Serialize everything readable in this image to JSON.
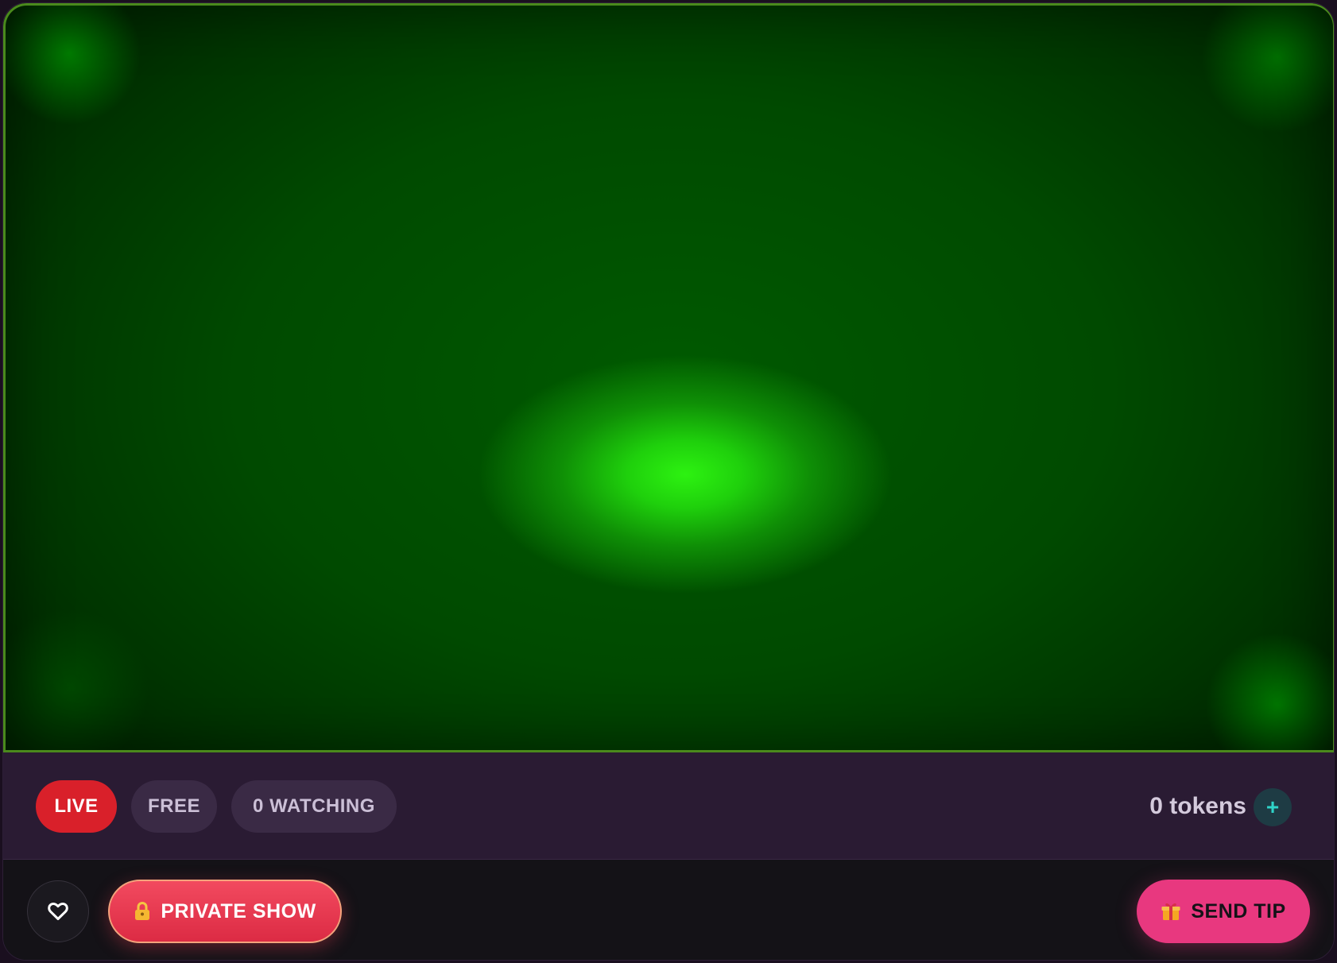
{
  "status": {
    "live_label": "LIVE",
    "access_label": "FREE",
    "watching_label": "0 WATCHING"
  },
  "wallet": {
    "tokens_label": "0 tokens",
    "add_label": "+"
  },
  "actions": {
    "private_show_label": "PRIVATE SHOW",
    "send_tip_label": "SEND TIP"
  },
  "colors": {
    "live": "#d9202a",
    "private_show": "#e8354e",
    "send_tip": "#e8387f",
    "video_border": "#4a8a1c"
  },
  "icons": {
    "favorite": "heart-icon",
    "private_show": "lock-icon",
    "send_tip": "gift-icon",
    "add_tokens": "plus-icon"
  }
}
